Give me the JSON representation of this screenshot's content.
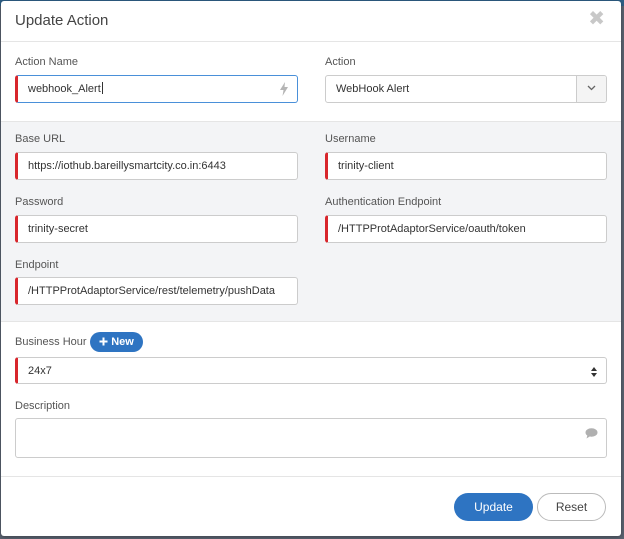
{
  "dialog": {
    "title": "Update Action",
    "close_glyph": "✖"
  },
  "fields": {
    "action_name": {
      "label": "Action Name",
      "value": "webhook_Alert",
      "icon": "bolt-icon"
    },
    "action": {
      "label": "Action",
      "value": "WebHook Alert"
    },
    "base_url": {
      "label": "Base URL",
      "value": "https://iothub.bareillysmartcity.co.in:6443"
    },
    "username": {
      "label": "Username",
      "value": "trinity-client"
    },
    "password": {
      "label": "Password",
      "value": "trinity-secret"
    },
    "auth_endpoint": {
      "label": "Authentication Endpoint",
      "value": "/HTTPProtAdaptorService/oauth/token"
    },
    "endpoint": {
      "label": "Endpoint",
      "value": "/HTTPProtAdaptorService/rest/telemetry/pushData"
    },
    "business_hour": {
      "label": "Business Hour",
      "value": "24x7",
      "new_label": "New"
    },
    "description": {
      "label": "Description",
      "value": "",
      "icon": "comment-icon"
    }
  },
  "footer": {
    "update_label": "Update",
    "reset_label": "Reset"
  },
  "colors": {
    "accent": "#2e74c2",
    "required": "#d8262c",
    "topbar": "#2e5f86"
  }
}
